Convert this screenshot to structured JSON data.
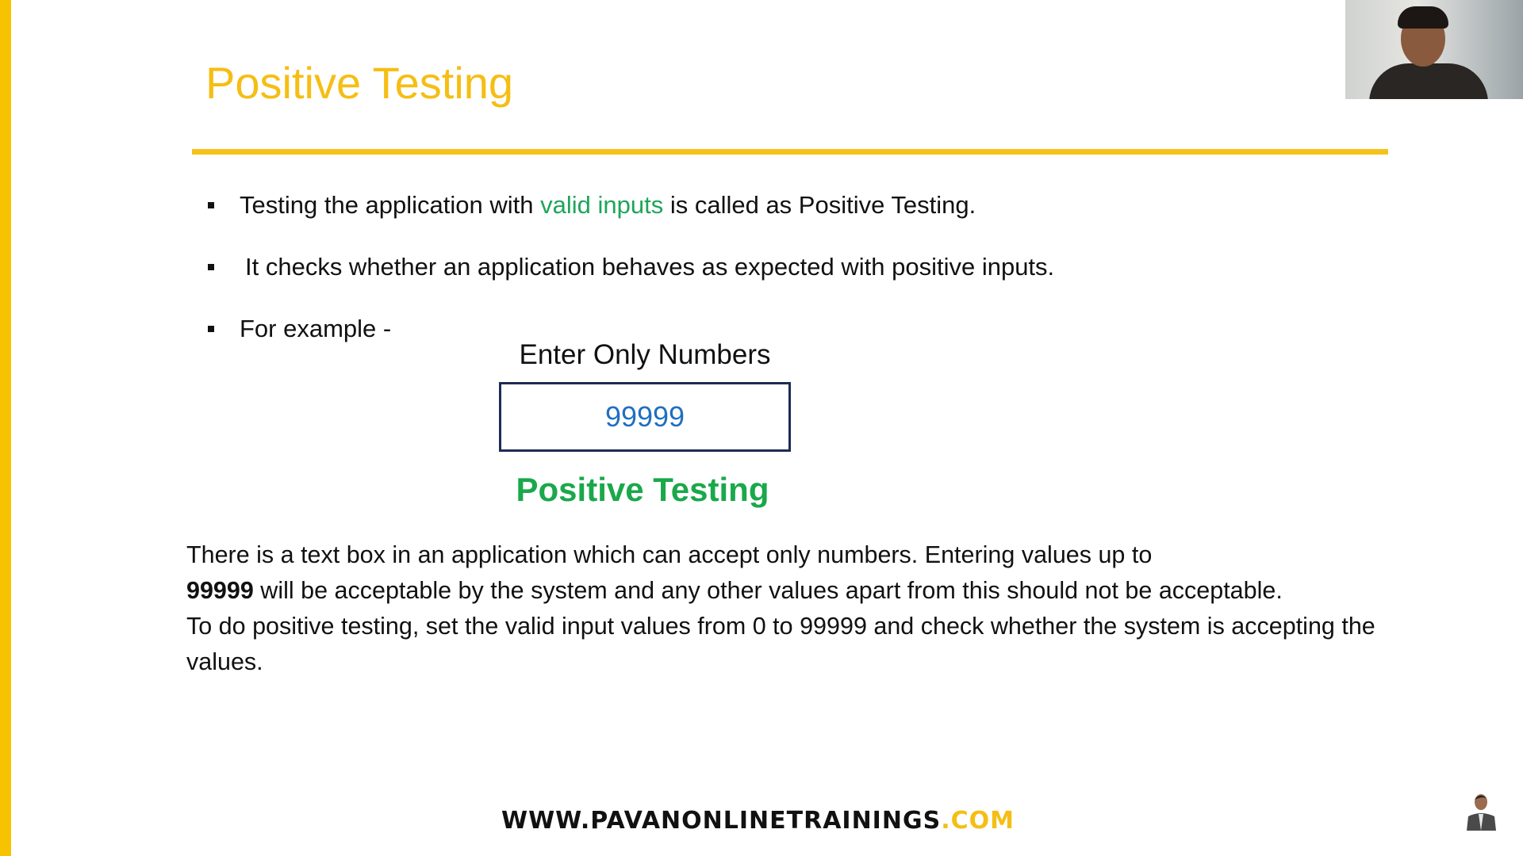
{
  "slide": {
    "title": "Positive Testing",
    "bullets": [
      {
        "before": "Testing the application with ",
        "highlight": "valid inputs",
        "after": " is called as Positive Testing."
      },
      {
        "text": "It checks whether an application behaves as expected with positive inputs."
      },
      {
        "text": "For example -"
      }
    ],
    "example": {
      "label": "Enter Only Numbers",
      "input_value": "99999",
      "caption": "Positive Testing"
    },
    "paragraph": {
      "line1": "There is a text box in an application which can accept only numbers. Entering values up to",
      "bold_value": "99999",
      "line2_rest": " will be acceptable by the system and any other values apart from this should not be acceptable.",
      "line3": "To do positive testing, set the valid input values from 0 to 99999 and check whether the system is accepting the values."
    },
    "footer": {
      "domain": "WWW.PAVANONLINETRAININGS",
      "tld": ".COM"
    }
  },
  "colors": {
    "accent": "#f5be14",
    "green": "#1aa84b",
    "input_blue": "#1f6fc0"
  }
}
